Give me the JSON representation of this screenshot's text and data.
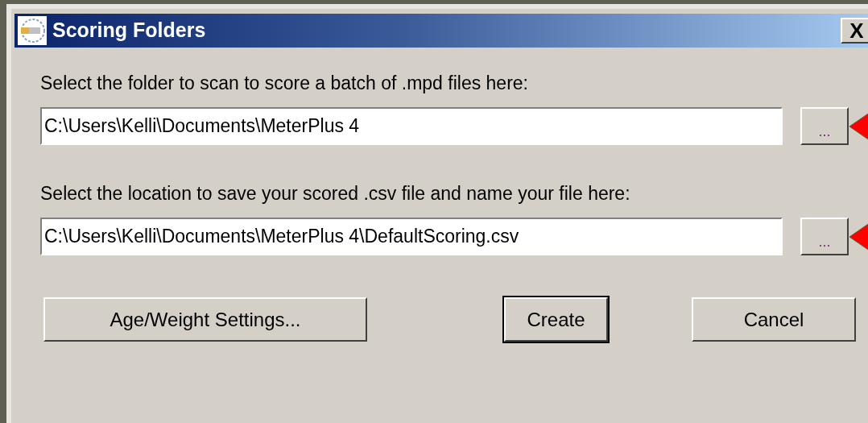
{
  "window": {
    "title": "Scoring Folders",
    "close": "X"
  },
  "sections": [
    {
      "label": "Select the folder to scan to score a batch of .mpd files here:",
      "value": "C:\\Users\\Kelli\\Documents\\MeterPlus 4",
      "browse": "...",
      "highlighted": true
    },
    {
      "label": "Select the location to save your scored .csv file and name your file here:",
      "value": "C:\\Users\\Kelli\\Documents\\MeterPlus 4\\DefaultScoring.csv",
      "browse": "...",
      "highlighted": true
    }
  ],
  "buttons": [
    {
      "label": "Age/Weight Settings...",
      "default": false
    },
    {
      "label": "Create",
      "default": true
    },
    {
      "label": "Cancel",
      "default": false
    }
  ]
}
